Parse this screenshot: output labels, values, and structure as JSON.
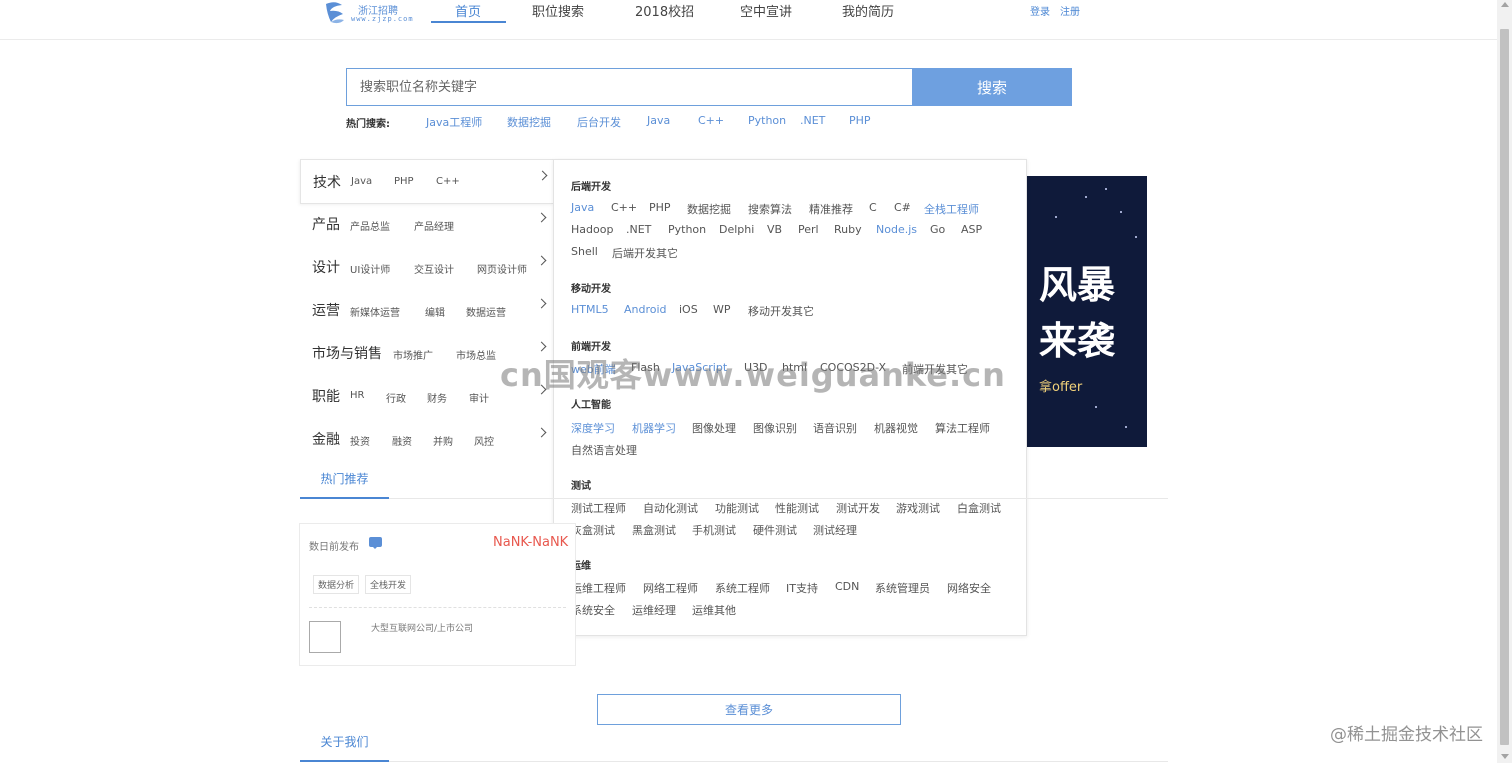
{
  "header": {
    "logo_text": "浙江招聘",
    "logo_sub": "www.zjzp.com",
    "nav": [
      "首页",
      "职位搜索",
      "2018校招",
      "空中宣讲",
      "我的简历"
    ],
    "login": "登录",
    "register": "注册"
  },
  "search": {
    "placeholder": "搜索职位名称关键字",
    "button": "搜索",
    "hot_label": "热门搜索:",
    "hot_keywords": [
      "Java工程师",
      "数据挖掘",
      "后台开发",
      "Java",
      "C++",
      "Python",
      ".NET",
      "PHP"
    ]
  },
  "categories": [
    {
      "title": "技术",
      "subs": [
        "Java",
        "PHP",
        "C++"
      ]
    },
    {
      "title": "产品",
      "subs": [
        "产品总监",
        "产品经理"
      ]
    },
    {
      "title": "设计",
      "subs": [
        "UI设计师",
        "交互设计",
        "网页设计师"
      ]
    },
    {
      "title": "运营",
      "subs": [
        "新媒体运营",
        "编辑",
        "数据运营"
      ]
    },
    {
      "title": "市场与销售",
      "subs": [
        "市场推广",
        "市场总监"
      ]
    },
    {
      "title": "职能",
      "subs": [
        "HR",
        "行政",
        "财务",
        "审计"
      ]
    },
    {
      "title": "金融",
      "subs": [
        "投资",
        "融资",
        "并购",
        "风控"
      ]
    }
  ],
  "panel": {
    "groups": [
      {
        "title": "后端开发",
        "rows": [
          [
            "Java",
            "C++",
            "PHP",
            "数据挖掘",
            "搜索算法",
            "精准推荐",
            "C",
            "C#",
            "全栈工程师"
          ],
          [
            "Hadoop",
            ".NET",
            "Python",
            "Delphi",
            "VB",
            "Perl",
            "Ruby",
            "Node.js",
            "Go",
            "ASP"
          ],
          [
            "Shell",
            "后端开发其它"
          ]
        ]
      },
      {
        "title": "移动开发",
        "rows": [
          [
            "HTML5",
            "Android",
            "iOS",
            "WP",
            "移动开发其它"
          ]
        ]
      },
      {
        "title": "前端开发",
        "rows": [
          [
            "web前端",
            "Flash",
            "JavaScript",
            "U3D",
            "html",
            "COCOS2D-X",
            "前端开发其它"
          ]
        ]
      },
      {
        "title": "人工智能",
        "rows": [
          [
            "深度学习",
            "机器学习",
            "图像处理",
            "图像识别",
            "语音识别",
            "机器视觉",
            "算法工程师"
          ],
          [
            "自然语言处理"
          ]
        ]
      },
      {
        "title": "测试",
        "rows": [
          [
            "测试工程师",
            "自动化测试",
            "功能测试",
            "性能测试",
            "测试开发",
            "游戏测试",
            "白盒测试"
          ],
          [
            "灰盒测试",
            "黑盒测试",
            "手机测试",
            "硬件测试",
            "测试经理"
          ]
        ]
      },
      {
        "title": "运维",
        "rows": [
          [
            "运维工程师",
            "网络工程师",
            "系统工程师",
            "IT支持",
            "CDN",
            "系统管理员",
            "网络安全"
          ],
          [
            "系统安全",
            "运维经理",
            "运维其他"
          ]
        ]
      }
    ]
  },
  "banner": {
    "line1": "风暴",
    "line2": "来袭",
    "small": "拿offer"
  },
  "hot": {
    "tab": "热门推荐",
    "job": {
      "date": "数日前发布",
      "salary": "NaNK-NaNK",
      "tags": [
        "数据分析",
        "全栈开发"
      ],
      "company_type": "大型互联网公司/上市公司"
    },
    "more": "查看更多"
  },
  "about": {
    "tab": "关于我们"
  },
  "watermarks": {
    "center": "cn国观客www.weiguanke.cn",
    "corner": "@稀土掘金技术社区"
  },
  "colors": {
    "accent": "#4a86d3",
    "search_button": "#6ea0e0",
    "salary": "#e8584e",
    "banner_bg": "#0f1a3a"
  }
}
